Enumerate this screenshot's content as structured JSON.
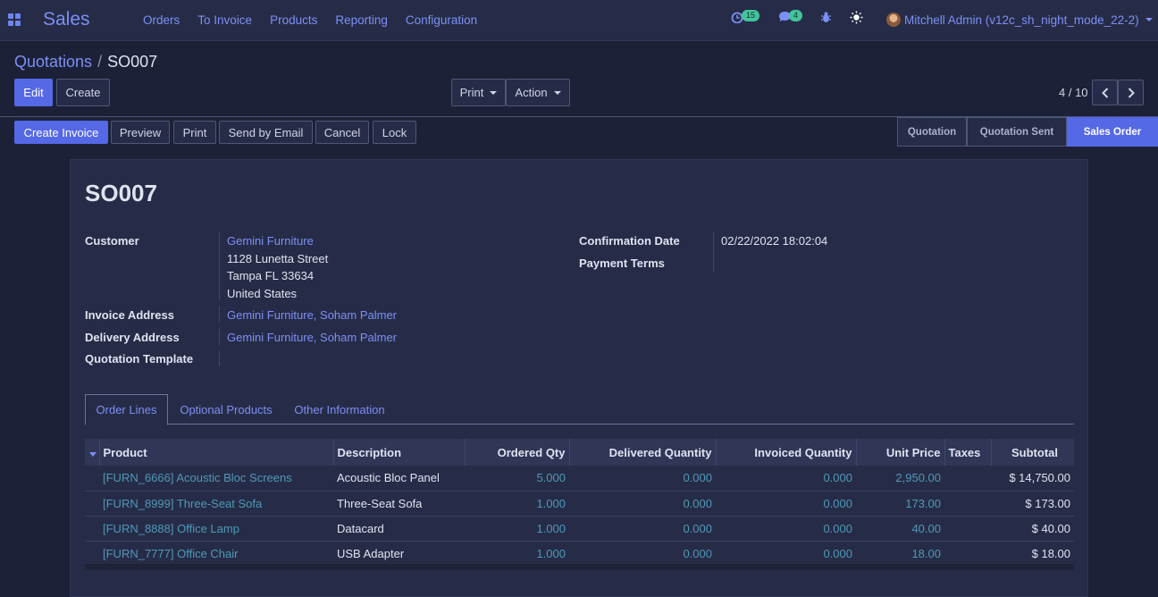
{
  "navbar": {
    "app_name": "Sales",
    "menu": [
      "Orders",
      "To Invoice",
      "Products",
      "Reporting",
      "Configuration"
    ],
    "activity_count": "15",
    "message_count": "4",
    "user": "Mitchell Admin (v12c_sh_night_mode_22-2)",
    "icons": [
      "apps-icon",
      "clock-icon",
      "chat-icon",
      "bug-icon",
      "sun-icon",
      "avatar"
    ]
  },
  "breadcrumb": {
    "parent": "Quotations",
    "separator": "/",
    "current": "SO007"
  },
  "toolbar": {
    "edit": "Edit",
    "create": "Create",
    "print": "Print",
    "action": "Action",
    "pager": "4 / 10"
  },
  "statusbar": {
    "buttons": [
      "Create Invoice",
      "Preview",
      "Print",
      "Send by Email",
      "Cancel",
      "Lock"
    ],
    "stages": [
      "Quotation",
      "Quotation Sent",
      "Sales Order"
    ],
    "active_stage": "Sales Order"
  },
  "form": {
    "name": "SO007",
    "customer_label": "Customer",
    "customer_name": "Gemini Furniture",
    "customer_street": "1128 Lunetta Street",
    "customer_city": "Tampa FL 33634",
    "customer_country": "United States",
    "invoice_address_label": "Invoice Address",
    "invoice_address": "Gemini Furniture, Soham Palmer",
    "delivery_address_label": "Delivery Address",
    "delivery_address": "Gemini Furniture, Soham Palmer",
    "template_label": "Quotation Template",
    "confirmation_date_label": "Confirmation Date",
    "confirmation_date": "02/22/2022 18:02:04",
    "payment_terms_label": "Payment Terms"
  },
  "tabs": [
    "Order Lines",
    "Optional Products",
    "Other Information"
  ],
  "order_lines": {
    "columns": [
      "Product",
      "Description",
      "Ordered Qty",
      "Delivered Quantity",
      "Invoiced Quantity",
      "Unit Price",
      "Taxes",
      "Subtotal"
    ],
    "rows": [
      [
        "[FURN_6666] Acoustic Bloc Screens",
        "Acoustic Bloc Panel",
        "5.000",
        "0.000",
        "0.000",
        "2,950.00",
        "",
        "$ 14,750.00"
      ],
      [
        "[FURN_8999] Three-Seat Sofa",
        "Three-Seat Sofa",
        "1.000",
        "0.000",
        "0.000",
        "173.00",
        "",
        "$ 173.00"
      ],
      [
        "[FURN_8888] Office Lamp",
        "Datacard",
        "1.000",
        "0.000",
        "0.000",
        "40.00",
        "",
        "$ 40.00"
      ],
      [
        "[FURN_7777] Office Chair",
        "USB Adapter",
        "1.000",
        "0.000",
        "0.000",
        "18.00",
        "",
        "$ 18.00"
      ]
    ]
  },
  "colors": {
    "background": "#1c2137",
    "panel": "#262c47",
    "accent": "#5568e6",
    "link": "#7c8ff5",
    "badge": "#42c49a"
  }
}
